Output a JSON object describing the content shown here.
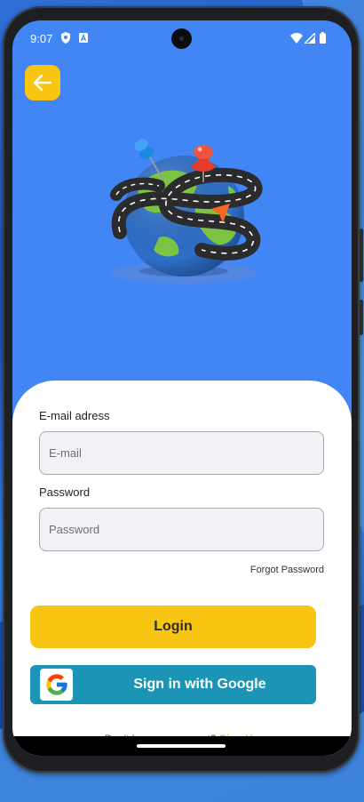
{
  "status_bar": {
    "time": "9:07",
    "icons": [
      "shield-icon",
      "a-badge-icon",
      "wifi-icon",
      "cell-signal-icon",
      "battery-icon"
    ]
  },
  "back_button": {
    "icon": "arrow-left-icon"
  },
  "hero": {
    "image": "globe-with-road-and-pins"
  },
  "form": {
    "email_label": "E-mail adress",
    "email_placeholder": "E-mail",
    "email_value": "",
    "password_label": "Password",
    "password_placeholder": "Password",
    "password_value": "",
    "forgot_password": "Forgot Password"
  },
  "buttons": {
    "login": "Login",
    "google": "Sign in with Google",
    "google_icon": "google-logo-icon"
  },
  "footer": {
    "prompt": "Don't have an account?",
    "signup": "Sign Up"
  },
  "colors": {
    "background": "#4285f4",
    "accent": "#f9c513",
    "google_button": "#1c94b5",
    "card": "#ffffff",
    "signup_link": "#f0b90b"
  }
}
